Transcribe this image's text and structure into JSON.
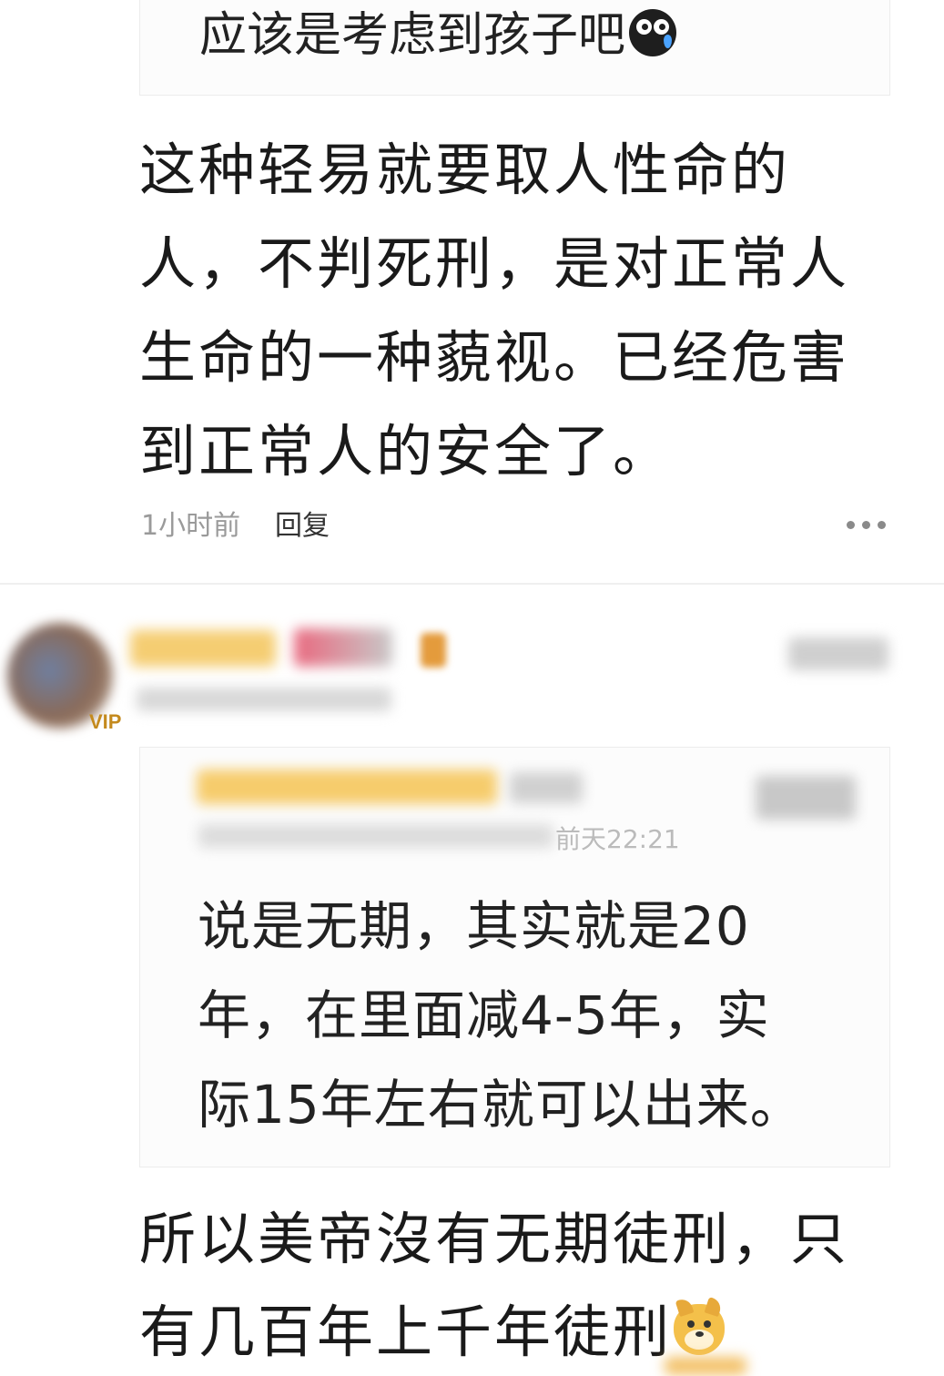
{
  "quote_top": {
    "text": "应该是考虑到孩子吧",
    "emoji": "crying-face-icon"
  },
  "comment1": {
    "lines": [
      "这种轻易就要取人性命的",
      "人，不判死刑，是对正常人",
      "生命的一种藐视。已经危害",
      "到正常人的安全了。"
    ],
    "time": "1小时前",
    "reply_label": "回复",
    "more_icon": "more-dots-icon"
  },
  "comment2": {
    "vip_badge": "VIP",
    "quoted": {
      "time": "前天22:21",
      "lines": [
        "说是无期，其实就是20",
        "年，在里面减4-5年，实",
        "际15年左右就可以出来。"
      ]
    },
    "lines": [
      "所以美帝沒有无期徒刑，只",
      "有几百年上千年徒刑"
    ],
    "emoji": "doge-face-icon"
  }
}
